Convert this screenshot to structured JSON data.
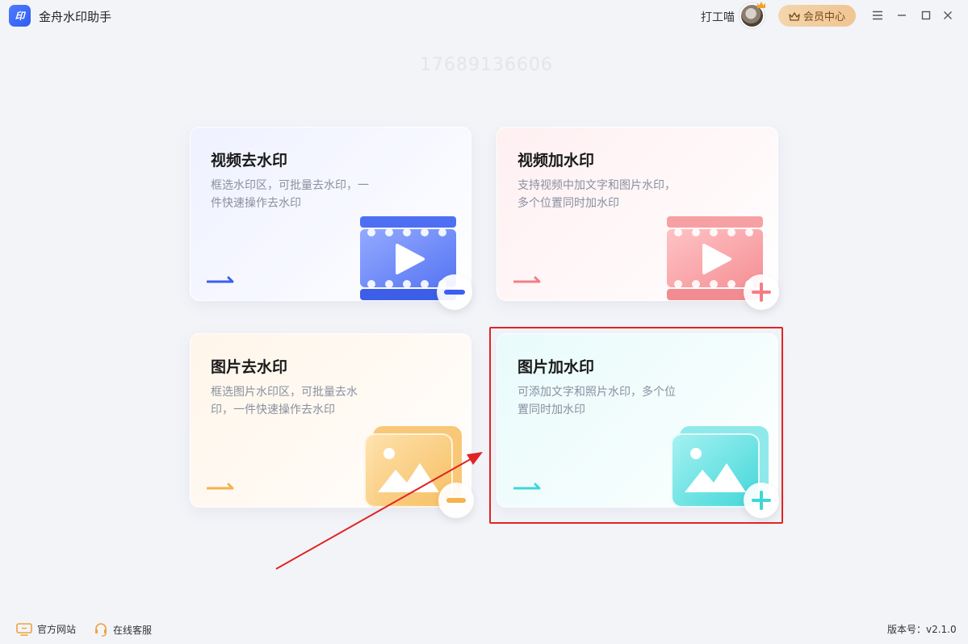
{
  "app": {
    "title": "金舟水印助手",
    "logo_text": "印"
  },
  "header": {
    "user_name": "打工喵",
    "vip_label": "会员中心"
  },
  "watermark_overlay": "17689136606",
  "cards": [
    {
      "title": "视频去水印",
      "desc": "框选水印区，可批量去水印，一件快速操作去水印",
      "accent": "#3b5ff0",
      "action": "minus"
    },
    {
      "title": "视频加水印",
      "desc": "支持视频中加文字和图片水印，多个位置同时加水印",
      "accent": "#f37e86",
      "action": "plus"
    },
    {
      "title": "图片去水印",
      "desc": "框选图片水印区，可批量去水印，一件快速操作去水印",
      "accent": "#f5b24f",
      "action": "minus"
    },
    {
      "title": "图片加水印",
      "desc": "可添加文字和照片水印，多个位置同时加水印",
      "accent": "#3fd6d8",
      "action": "plus"
    }
  ],
  "footer": {
    "website": "官方网站",
    "support": "在线客服",
    "version": "版本号：v2.1.0"
  },
  "icons": {
    "menu": "menu-icon",
    "minimize": "minimize-icon",
    "maximize": "maximize-icon",
    "close": "close-icon",
    "crown": "crown-icon",
    "monitor": "monitor-icon",
    "headset": "headset-icon"
  }
}
